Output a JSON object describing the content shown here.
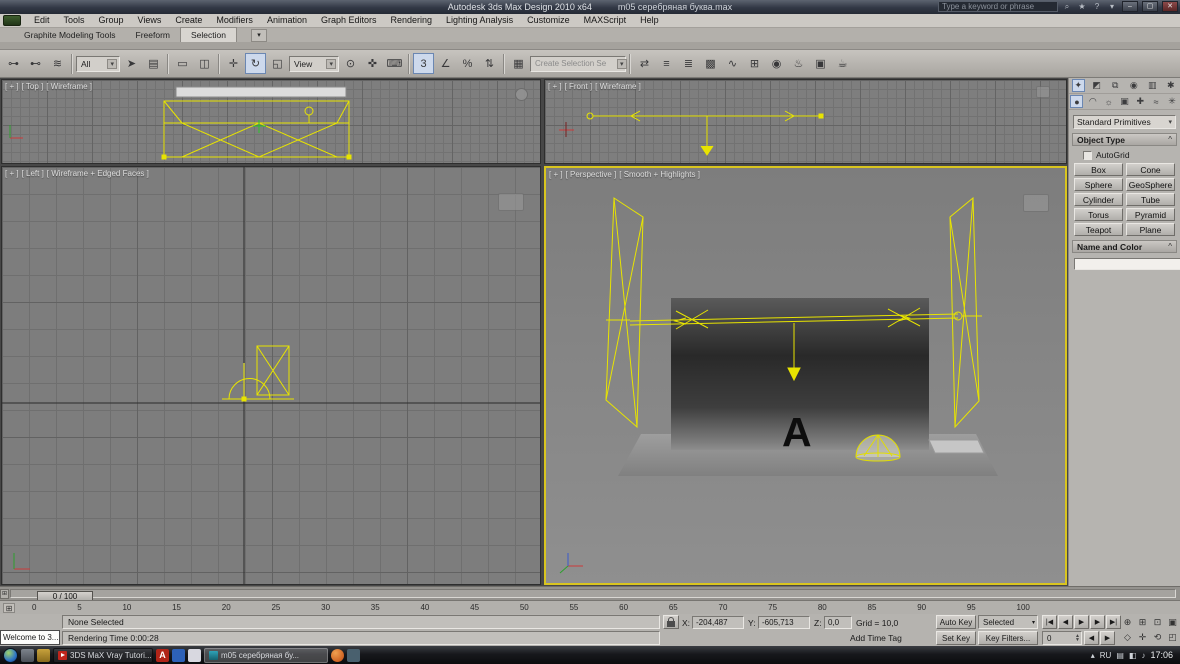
{
  "title_bar": {
    "app_title": "Autodesk 3ds Max Design 2010 x64",
    "doc_title": "m05 серебряная буква.max",
    "search_placeholder": "Type a keyword or phrase"
  },
  "menu_bar": [
    "Edit",
    "Tools",
    "Group",
    "Views",
    "Create",
    "Modifiers",
    "Animation",
    "Graph Editors",
    "Rendering",
    "Lighting Analysis",
    "Customize",
    "MAXScript",
    "Help"
  ],
  "ribbon_tabs": [
    "Graphite Modeling Tools",
    "Freeform",
    "Selection"
  ],
  "toolbar": {
    "selection_filter": "All",
    "ref_coord_system": "View",
    "selection_set_placeholder": "Create Selection Se"
  },
  "viewports": {
    "top": {
      "menu": "[ + ]",
      "name": "[ Top ]",
      "shading": "[ Wireframe ]"
    },
    "front": {
      "menu": "[ + ]",
      "name": "[ Front ]",
      "shading": "[ Wireframe ]"
    },
    "left": {
      "menu": "[ + ]",
      "name": "[ Left ]",
      "shading": "[ Wireframe + Edged Faces ]"
    },
    "perspective": {
      "menu": "[ + ]",
      "name": "[ Perspective ]",
      "shading": "[ Smooth + Highlights ]",
      "letter": "A"
    }
  },
  "command_panel": {
    "category_dropdown": "Standard Primitives",
    "object_type_rollout": "Object Type",
    "autogrid_label": "AutoGrid",
    "object_buttons": [
      "Box",
      "Cone",
      "Sphere",
      "GeoSphere",
      "Cylinder",
      "Tube",
      "Torus",
      "Pyramid",
      "Teapot",
      "Plane"
    ],
    "name_color_rollout": "Name and Color"
  },
  "timeline": {
    "slider_label": "0 / 100",
    "ticks": [
      "0",
      "5",
      "10",
      "15",
      "20",
      "25",
      "30",
      "35",
      "40",
      "45",
      "50",
      "55",
      "60",
      "65",
      "70",
      "75",
      "80",
      "85",
      "90",
      "95",
      "100"
    ]
  },
  "status_bar": {
    "welcome_popup": "Welcome to 3...",
    "selection_status": "None Selected",
    "render_time": "Rendering Time  0:00:28",
    "coord_x_label": "X:",
    "coord_x": "-204,487",
    "coord_y_label": "Y:",
    "coord_y": "-605,713",
    "coord_z_label": "Z:",
    "coord_z": "0,0",
    "grid_size": "Grid = 10,0",
    "add_time_tag": "Add Time Tag",
    "auto_key": "Auto Key",
    "set_key": "Set Key",
    "key_mode_dropdown": "Selected",
    "key_filters": "Key Filters...",
    "current_frame": "0"
  },
  "taskbar": {
    "window1": "3DS MaX Vray Tutori...",
    "window2": "m05 серебряная бу...",
    "lang": "RU",
    "clock": "17:06"
  },
  "colors": {
    "active_viewport_border": "#d9c51f",
    "wireframe_yellow": "#e8e400",
    "object_color_swatch": "#a8141c"
  },
  "icons": {
    "minimize": "–",
    "maximize": "▢",
    "close": "✕",
    "search": "⌕",
    "star": "★",
    "help": "?",
    "dropdown": "▾",
    "ribbon_overflow": "▾",
    "timeline_config": "⊞",
    "link": "⊶",
    "unlink": "⊷",
    "bind": "≋",
    "select": "➤",
    "select_by_name": "▤",
    "region": "▭",
    "crossing": "◫",
    "move": "✛",
    "rotate": "↻",
    "scale": "◱",
    "pivot": "⊙",
    "manipulate": "✜",
    "kbd": "⌨",
    "snap": "3",
    "angle": "∠",
    "percent": "%",
    "spinner": "⇅",
    "named_sets": "▦",
    "mirror": "⇄",
    "align": "≡",
    "layers": "≣",
    "graphite": "▩",
    "curves": "∿",
    "schematic": "⊞",
    "material": "◉",
    "render_setup": "♨",
    "frame_buffer": "▣",
    "render": "☕",
    "start": "|◀",
    "prev": "◀",
    "play": "▶",
    "next": "▶",
    "end": "▶|",
    "zoom": "⊕",
    "zoom_all": "⊞",
    "extents": "⊡",
    "extents_all": "▣",
    "pan": "✛",
    "orbit": "⟲",
    "fov": "◇",
    "maximize_vp": "◰",
    "create": "✦",
    "modify": "◩",
    "hierarchy": "⧉",
    "motion": "◉",
    "display": "▥",
    "utilities": "✱",
    "geometry": "●",
    "shapes": "◠",
    "lights": "☼",
    "cameras": "▣",
    "helpers": "✚",
    "spacewarps": "≈",
    "systems": "✳",
    "rollout_open": "^",
    "tray_up": "▴",
    "tray_kb": "▤",
    "tray_net": "◧",
    "tray_vol": "♪"
  }
}
